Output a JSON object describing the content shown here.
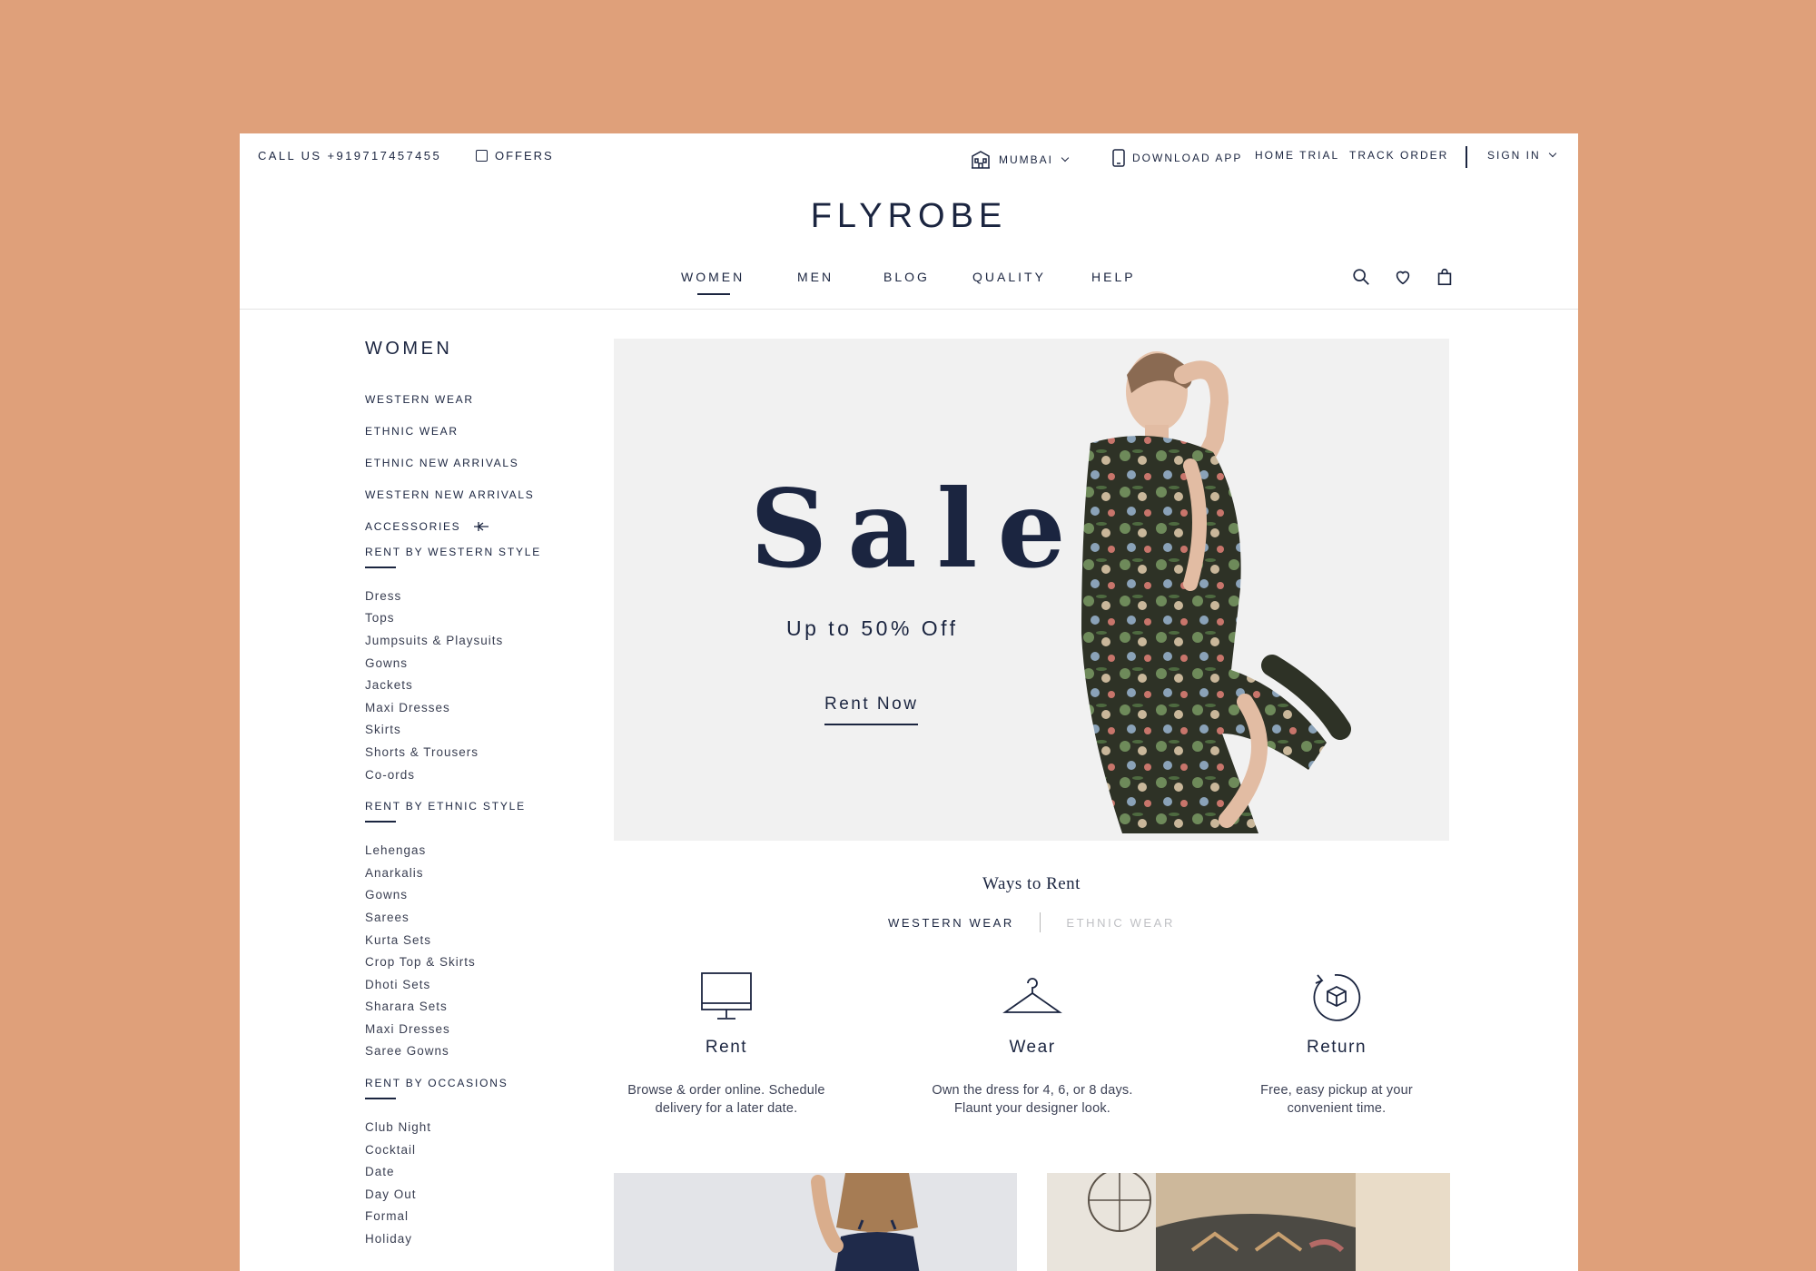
{
  "utility": {
    "call": "CALL US +919717457455",
    "offers": "OFFERS",
    "city": "MUMBAI",
    "download": "DOWNLOAD APP",
    "trial": "HOME TRIAL",
    "track": "TRACK ORDER",
    "signin": "SIGN IN"
  },
  "logo": "FLYROBE",
  "nav": {
    "women": "WOMEN",
    "men": "MEN",
    "blog": "BLOG",
    "quality": "QUALITY",
    "help": "HELP"
  },
  "sidebar": {
    "title": "WOMEN",
    "main": [
      "WESTERN WEAR",
      "ETHNIC WEAR",
      "ETHNIC NEW ARRIVALS",
      "WESTERN NEW ARRIVALS",
      "ACCESSORIES"
    ],
    "western": {
      "title": "RENT BY WESTERN STYLE",
      "items": [
        "Dress",
        "Tops",
        "Jumpsuits & Playsuits",
        "Gowns",
        "Jackets",
        "Maxi Dresses",
        "Skirts",
        "Shorts & Trousers",
        "Co-ords"
      ]
    },
    "ethnic": {
      "title": "RENT BY ETHNIC STYLE",
      "items": [
        "Lehengas",
        "Anarkalis",
        "Gowns",
        "Sarees",
        "Kurta Sets",
        "Crop Top & Skirts",
        "Dhoti Sets",
        "Sharara Sets",
        "Maxi Dresses",
        "Saree Gowns"
      ]
    },
    "occasions": {
      "title": "RENT BY OCCASIONS",
      "items": [
        "Club Night",
        "Cocktail",
        "Date",
        "Day Out",
        "Formal",
        "Holiday"
      ]
    }
  },
  "hero": {
    "title": "Sale",
    "subtitle": "Up to 50% Off",
    "cta": "Rent Now"
  },
  "ways": {
    "title": "Ways to Rent",
    "tab_western": "WESTERN WEAR",
    "tab_ethnic": "ETHNIC WEAR",
    "steps": [
      {
        "name": "Rent",
        "desc1": "Browse & order online. Schedule",
        "desc2": "delivery for a later date.",
        "icon": "monitor-icon"
      },
      {
        "name": "Wear",
        "desc1": "Own the dress for 4, 6, or 8 days.",
        "desc2": "Flaunt your designer look.",
        "icon": "hanger-icon"
      },
      {
        "name": "Return",
        "desc1": "Free, easy pickup at your",
        "desc2": "convenient time.",
        "icon": "return-box-icon"
      }
    ]
  },
  "colors": {
    "navy": "#1b2540",
    "background": "#dfa07a",
    "inactive_tab": "#bfc0c4"
  }
}
